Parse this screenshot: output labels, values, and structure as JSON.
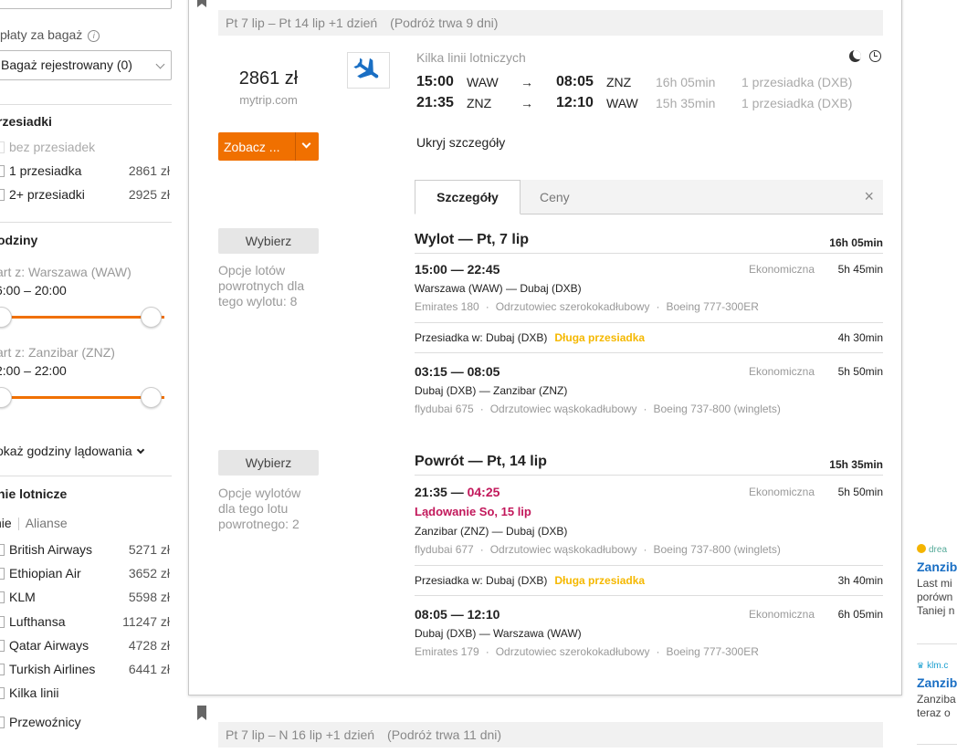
{
  "sidebar": {
    "bag_label": "płaty za bagaż",
    "bag_info_icon": "info-icon",
    "bag_select_value": "Bagaż rejestrowany (0)",
    "stops_heading": "rzesiadki",
    "stops": [
      {
        "label": "bez przesiadek",
        "price": "",
        "disabled": true
      },
      {
        "label": "1 przesiadka",
        "price": "2861 zł"
      },
      {
        "label": "2+ przesiadki",
        "price": "2925 zł"
      }
    ],
    "hours_heading": "odziny",
    "departure_label": "art z: Warszawa (WAW)",
    "departure_range": "6:00 – 20:00",
    "return_label": "art z: Zanzibar (ZNZ)",
    "return_range": "2:00 – 22:00",
    "show_landing": "okaż godziny lądowania",
    "airlines_heading": "nie lotnicze",
    "airlines_tab_1": "nie",
    "airlines_tab_2": "Alianse",
    "airlines": [
      {
        "label": "British Airways",
        "price": "5271 zł"
      },
      {
        "label": "Ethiopian Air",
        "price": "3652 zł"
      },
      {
        "label": "KLM",
        "price": "5598 zł"
      },
      {
        "label": "Lufthansa",
        "price": "11247 zł"
      },
      {
        "label": "Qatar Airways",
        "price": "4728 zł"
      },
      {
        "label": "Turkish Airlines",
        "price": "6441 zł"
      },
      {
        "label": "Kilka linii",
        "price": ""
      }
    ],
    "carriers_label": "Przewoźnicy"
  },
  "result": {
    "dates": "Pt 7 lip – Pt 14 lip +1 dzień",
    "trip_duration": "(Podróż trwa 9 dni)",
    "price": "2861 zł",
    "provider": "mytrip.com",
    "see_button": "Zobacz ...",
    "airline_name": "Kilka linii lotniczych",
    "legs": [
      {
        "dep_time": "15:00",
        "dep_ap": "WAW",
        "arr_time": "08:05",
        "arr_ap": "ZNZ",
        "duration": "16h 05min",
        "stops": "1 przesiadka (DXB)"
      },
      {
        "dep_time": "21:35",
        "dep_ap": "ZNZ",
        "arr_time": "12:10",
        "arr_ap": "WAW",
        "duration": "15h 35min",
        "stops": "1 przesiadka (DXB)"
      }
    ],
    "arrow": "→",
    "hide_details": "Ukryj szczegóły",
    "tab_details": "Szczegóły",
    "tab_prices": "Ceny",
    "close": "×",
    "choose_label": "Wybierz",
    "outbound": {
      "title": "Wylot — Pt, 7 lip",
      "duration": "16h 05min",
      "options": "Opcje lotów powrotnych dla tego wylotu: 8",
      "seg1": {
        "time": "15:00 — 22:45",
        "cls": "Ekonomiczna",
        "dur": "5h 45min",
        "route": "Warszawa (WAW) — Dubaj (DXB)",
        "flight": "Emirates 180",
        "aircraft": "Odrzutowiec szerokokadłubowy",
        "model": "Boeing 777-300ER"
      },
      "layover": {
        "text": "Przesiadka w: Dubaj (DXB)",
        "long": "Długa przesiadka",
        "dur": "4h 30min"
      },
      "seg2": {
        "time": "03:15 — 08:05",
        "cls": "Ekonomiczna",
        "dur": "5h 50min",
        "route": "Dubaj (DXB) — Zanzibar (ZNZ)",
        "flight": "flydubai 675",
        "aircraft": "Odrzutowiec wąskokadłubowy",
        "model": "Boeing 737-800 (winglets)"
      }
    },
    "return": {
      "title": "Powrót — Pt, 14 lip",
      "duration": "15h 35min",
      "options": "Opcje wylotów dla tego lotu powrotnego: 2",
      "seg1": {
        "time_dep": "21:35 — ",
        "time_arr": "04:25",
        "landing": "Lądowanie So, 15 lip",
        "cls": "Ekonomiczna",
        "dur": "5h 50min",
        "route": "Zanzibar (ZNZ) — Dubaj (DXB)",
        "flight": "flydubai 677",
        "aircraft": "Odrzutowiec wąskokadłubowy",
        "model": "Boeing 737-800 (winglets)"
      },
      "layover": {
        "text": "Przesiadka w: Dubaj (DXB)",
        "long": "Długa przesiadka",
        "dur": "3h 40min"
      },
      "seg2": {
        "time": "08:05 — 12:10",
        "cls": "Ekonomiczna",
        "dur": "6h 05min",
        "route": "Dubaj (DXB) — Warszawa (WAW)",
        "flight": "Emirates 179",
        "aircraft": "Odrzutowiec szerokokadłubowy",
        "model": "Boeing 777-300ER"
      }
    }
  },
  "next_result": {
    "dates": "Pt 7 lip – N 16 lip +1 dzień",
    "trip_duration": "(Podróż trwa 11 dni)"
  },
  "ads": [
    {
      "source": "drea",
      "title": "Zanzib",
      "lines": [
        "Last mi",
        "porówn",
        "Taniej n"
      ]
    },
    {
      "source": "klm.c",
      "title": "Zanzib",
      "lines": [
        "Zanziba",
        "teraz o"
      ]
    }
  ],
  "colors": {
    "accent": "#f07000",
    "warning": "#f5b800",
    "landing": "#c2185b",
    "link": "#1a6fc4"
  }
}
